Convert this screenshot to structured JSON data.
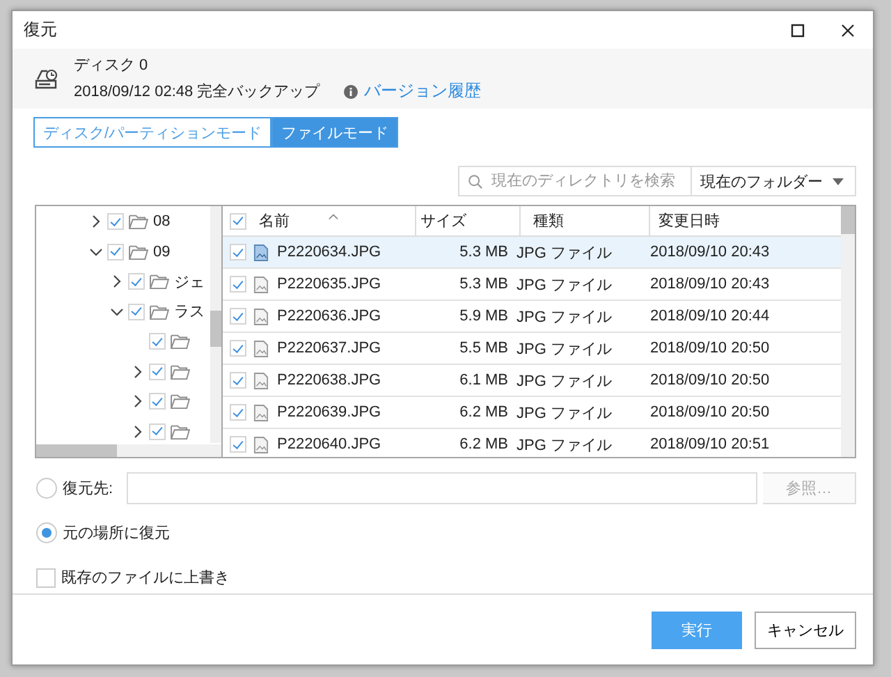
{
  "window": {
    "title": "復元"
  },
  "source": {
    "disk": "ディスク 0",
    "backup": "2018/09/12 02:48 完全バックアップ",
    "history_link": "バージョン履歴"
  },
  "tabs": [
    {
      "label": "ディスク/パーティションモード",
      "selected": false
    },
    {
      "label": "ファイルモード",
      "selected": true
    }
  ],
  "search": {
    "placeholder": "現在のディレクトリを検索",
    "scope": "現在のフォルダー"
  },
  "tree": [
    {
      "name": "08",
      "expanded": false,
      "checked": true
    },
    {
      "name": "09",
      "expanded": true,
      "checked": true,
      "children": [
        {
          "name": "ジェ",
          "expanded": false,
          "checked": true
        },
        {
          "name": "ラス",
          "expanded": true,
          "checked": true,
          "children": [
            {
              "checked": true
            },
            {
              "expanded": false,
              "checked": true
            },
            {
              "expanded": false,
              "checked": true
            },
            {
              "expanded": false,
              "checked": true
            }
          ]
        }
      ]
    }
  ],
  "table": {
    "all_checked": true,
    "columns": [
      "名前",
      "サイズ",
      "種類",
      "変更日時"
    ],
    "rows": [
      {
        "name": "P2220634.JPG",
        "size": "5.3 MB",
        "type": "JPG ファイル",
        "modified": "2018/09/10 20:43",
        "checked": true,
        "selected": true
      },
      {
        "name": "P2220635.JPG",
        "size": "5.3 MB",
        "type": "JPG ファイル",
        "modified": "2018/09/10 20:43",
        "checked": true,
        "selected": false
      },
      {
        "name": "P2220636.JPG",
        "size": "5.9 MB",
        "type": "JPG ファイル",
        "modified": "2018/09/10 20:44",
        "checked": true,
        "selected": false
      },
      {
        "name": "P2220637.JPG",
        "size": "5.5 MB",
        "type": "JPG ファイル",
        "modified": "2018/09/10 20:50",
        "checked": true,
        "selected": false
      },
      {
        "name": "P2220638.JPG",
        "size": "6.1 MB",
        "type": "JPG ファイル",
        "modified": "2018/09/10 20:50",
        "checked": true,
        "selected": false
      },
      {
        "name": "P2220639.JPG",
        "size": "6.2 MB",
        "type": "JPG ファイル",
        "modified": "2018/09/10 20:50",
        "checked": true,
        "selected": false
      },
      {
        "name": "P2220640.JPG",
        "size": "6.2 MB",
        "type": "JPG ファイル",
        "modified": "2018/09/10 20:51",
        "checked": true,
        "selected": false
      }
    ]
  },
  "destination": {
    "options": [
      {
        "label": "復元先:",
        "selected": false,
        "kind": "path"
      },
      {
        "label": "元の場所に復元",
        "selected": true,
        "kind": "plain"
      }
    ],
    "browse": "参照…",
    "overwrite": {
      "label": "既存のファイルに上書き",
      "checked": false
    }
  },
  "buttons": [
    {
      "label": "実行",
      "kind": "primary"
    },
    {
      "label": "キャンセル",
      "kind": "secondary"
    }
  ]
}
